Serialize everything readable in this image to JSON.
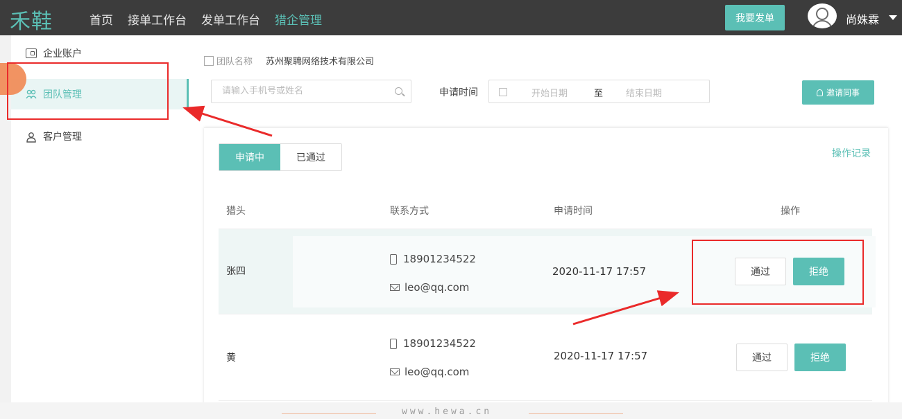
{
  "app": {
    "logo": "禾鞋"
  },
  "nav": [
    {
      "label": "首页",
      "active": false
    },
    {
      "label": "接单工作台",
      "active": false
    },
    {
      "label": "发单工作台",
      "active": false
    },
    {
      "label": "猎企管理",
      "active": true
    }
  ],
  "header": {
    "post_button": "我要发单",
    "username": "尚姝霖"
  },
  "sidebar": {
    "items": [
      {
        "label": "企业账户",
        "icon": "card-icon",
        "active": false
      },
      {
        "label": "团队管理",
        "icon": "team-icon",
        "active": true
      },
      {
        "label": "客户管理",
        "icon": "user-icon",
        "active": false
      }
    ]
  },
  "team": {
    "label": "团队名称",
    "name": "苏州聚聘网络技术有限公司"
  },
  "filters": {
    "search_placeholder": "请输入手机号或姓名",
    "apply_time_label": "申请时间",
    "start_placeholder": "开始日期",
    "separator": "至",
    "end_placeholder": "结束日期",
    "invite_button": "邀请同事"
  },
  "tabs": [
    {
      "label": "申请中",
      "active": true
    },
    {
      "label": "已通过",
      "active": false
    }
  ],
  "log_link": "操作记录",
  "table": {
    "headers": [
      "猎头",
      "联系方式",
      "申请时间",
      "操作"
    ],
    "rows": [
      {
        "name": "张四",
        "phone": "18901234522",
        "email": "leo@qq.com",
        "time": "2020-11-17 17:57",
        "approve": "通过",
        "reject": "拒绝"
      },
      {
        "name": "黄",
        "phone": "18901234522",
        "email": "leo@qq.com",
        "time": "2020-11-17 17:57",
        "approve": "通过",
        "reject": "拒绝"
      }
    ]
  },
  "footer": {
    "watermark": "www.hewa.cn"
  },
  "colors": {
    "accent": "#5bbfb5",
    "topbar": "#3c3c3c",
    "annotation": "#ea2a2a"
  }
}
